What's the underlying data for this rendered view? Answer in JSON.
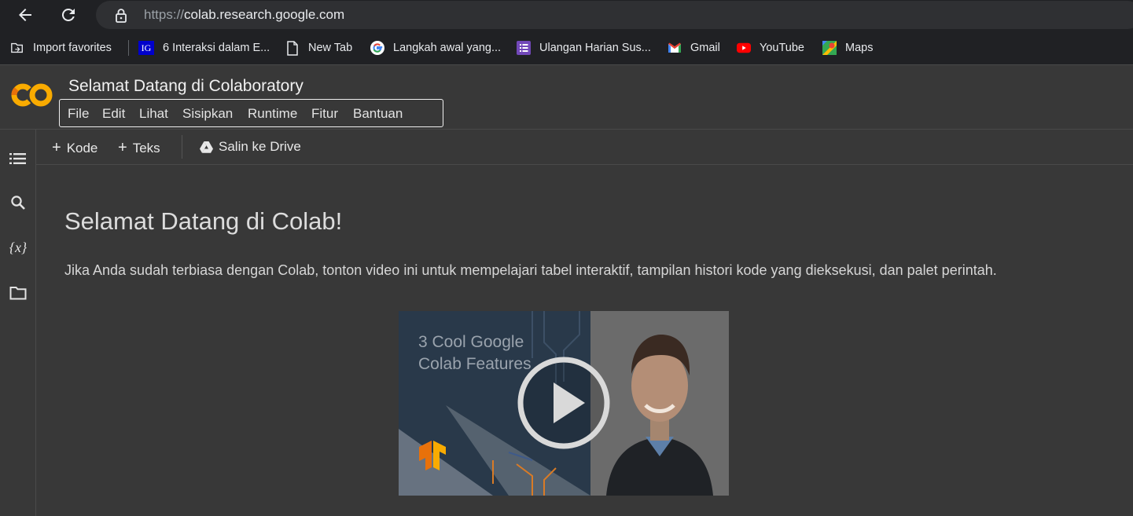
{
  "browser": {
    "url_scheme": "https://",
    "url_host": "colab.research.google.com",
    "bookmarks": [
      {
        "label": "Import favorites",
        "icon": "import-icon"
      },
      {
        "label": "6 Interaksi dalam E...",
        "icon": "ig-icon"
      },
      {
        "label": "New Tab",
        "icon": "page-icon"
      },
      {
        "label": "Langkah awal yang...",
        "icon": "google-icon"
      },
      {
        "label": "Ulangan Harian Sus...",
        "icon": "forms-icon"
      },
      {
        "label": "Gmail",
        "icon": "gmail-icon"
      },
      {
        "label": "YouTube",
        "icon": "youtube-icon"
      },
      {
        "label": "Maps",
        "icon": "maps-icon"
      }
    ]
  },
  "header": {
    "logo_text": "CO",
    "title": "Selamat Datang di Colaboratory",
    "menu": [
      "File",
      "Edit",
      "Lihat",
      "Sisipkan",
      "Runtime",
      "Fitur",
      "Bantuan"
    ]
  },
  "toolbar": {
    "add_code": "Kode",
    "add_text": "Teks",
    "copy_drive": "Salin ke Drive"
  },
  "rail": {
    "variables_label": "{x}"
  },
  "content": {
    "heading": "Selamat Datang di Colab!",
    "paragraph": "Jika Anda sudah terbiasa dengan Colab, tonton video ini untuk mempelajari tabel interaktif, tampilan histori kode yang dieksekusi, dan palet perintah.",
    "video_line1": "3 Cool Google",
    "video_line2": "Colab Features"
  },
  "colors": {
    "accent_orange": "#f9ab00",
    "background": "#383838",
    "chrome": "#202124"
  }
}
